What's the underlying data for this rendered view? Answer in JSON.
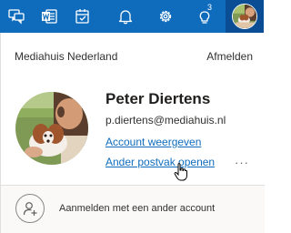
{
  "topbar": {
    "icons": [
      "chat-icon",
      "word-icon",
      "tasks-icon",
      "bell-icon",
      "gear-icon",
      "lightbulb-icon"
    ],
    "whats_new_badge": "3",
    "color": "#0f6cbd"
  },
  "account": {
    "organization": "Mediahuis Nederland",
    "sign_out_label": "Afmelden",
    "name": "Peter Diertens",
    "email": "p.diertens@mediahuis.nl",
    "view_account_label": "Account weergeven",
    "open_other_mailbox_label": "Ander postvak openen",
    "more_options": "···"
  },
  "footer": {
    "add_account_label": "Aanmelden met een ander account"
  },
  "colors": {
    "accent": "#0f6cbd",
    "link": "#0f6cbd"
  }
}
